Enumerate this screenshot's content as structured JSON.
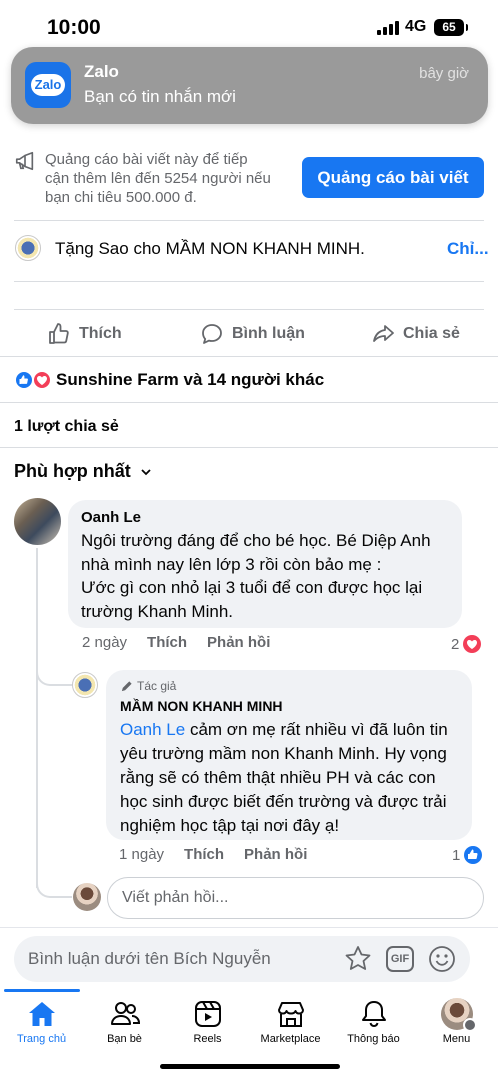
{
  "status_bar": {
    "time": "10:00",
    "network": "4G",
    "battery": "65"
  },
  "notification": {
    "app_icon_text": "Zalo",
    "app": "Zalo",
    "message": "Bạn có tin nhắn mới",
    "time": "bây giờ"
  },
  "promo": {
    "lines": [
      "Quảng cáo bài viết này để tiếp",
      "cận thêm lên đến 5254 người nếu",
      "bạn chi tiêu 500.000 đ."
    ],
    "button": "Quảng cáo bài viết"
  },
  "stars": {
    "text": "Tặng Sao cho MẦM NON KHANH MINH.",
    "more": "Chỉ..."
  },
  "actions": {
    "like": "Thích",
    "comment": "Bình luận",
    "share": "Chia sẻ"
  },
  "reactions": {
    "summary": "Sunshine Farm và 14 người khác"
  },
  "shares": "1 lượt chia sẻ",
  "sort_label": "Phù hợp nhất",
  "comments": [
    {
      "author": "Oanh Le",
      "lines": [
        "Ngôi trường đáng để cho bé học. Bé Diệp Anh",
        "nhà mình nay lên lớp 3 rồi còn bảo mẹ :",
        "Ước gì con nhỏ lại 3 tuổi để con được học lại",
        "trường Khanh Minh."
      ],
      "time": "2 ngày",
      "like": "Thích",
      "reply": "Phản hồi",
      "reaction_count": "2",
      "reaction_color": "#f33e58"
    },
    {
      "badge": "Tác giả",
      "author": "MẦM NON KHANH MINH",
      "mention": "Oanh Le",
      "first_line_rest": " cảm ơn mẹ rất nhiều vì đã luôn tin",
      "lines": [
        "yêu trường mầm non Khanh Minh. Hy vọng",
        "rằng sẽ có thêm thật nhiều PH và các con",
        "học sinh được biết đến trường và được trải",
        "nghiệm học tập tại nơi đây ạ!"
      ],
      "time": "1 ngày",
      "like": "Thích",
      "reply": "Phản hồi",
      "reaction_count": "1",
      "reaction_color": "#1877f2"
    }
  ],
  "reply_placeholder": "Viết phản hồi...",
  "comment_placeholder": "Bình luận dưới tên Bích Nguyễn",
  "gif_label": "GIF",
  "tabs": [
    {
      "label": "Trang chủ",
      "icon": "home-icon",
      "active": true
    },
    {
      "label": "Bạn bè",
      "icon": "friends-icon"
    },
    {
      "label": "Reels",
      "icon": "reels-icon"
    },
    {
      "label": "Marketplace",
      "icon": "marketplace-icon"
    },
    {
      "label": "Thông báo",
      "icon": "bell-icon"
    },
    {
      "label": "Menu",
      "icon": "profile-menu-icon"
    }
  ],
  "colors": {
    "accent": "#1877f2",
    "love": "#f33e58",
    "muted": "#65676b",
    "bubble": "#f0f2f5"
  }
}
